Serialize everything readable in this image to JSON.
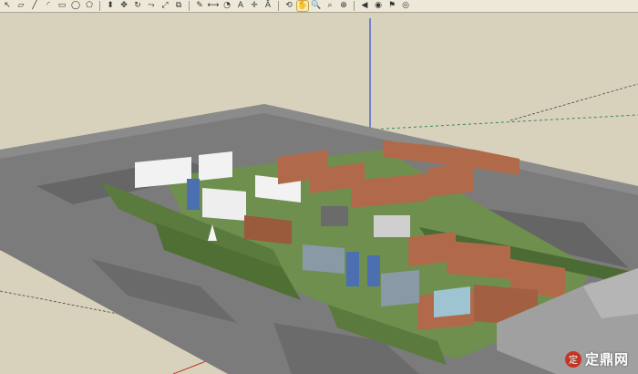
{
  "toolbar": {
    "tools": [
      {
        "name": "select-tool-icon",
        "glyph": "↖",
        "active": false
      },
      {
        "name": "eraser-tool-icon",
        "glyph": "▱",
        "active": false
      },
      {
        "name": "line-tool-icon",
        "glyph": "╱",
        "active": false
      },
      {
        "name": "arc-tool-icon",
        "glyph": "◜",
        "active": false
      },
      {
        "name": "rectangle-tool-icon",
        "glyph": "▭",
        "active": false
      },
      {
        "name": "circle-tool-icon",
        "glyph": "◯",
        "active": false
      },
      {
        "name": "polygon-tool-icon",
        "glyph": "⬠",
        "active": false
      },
      {
        "name": "push-pull-tool-icon",
        "glyph": "⬍",
        "active": false
      },
      {
        "name": "move-tool-icon",
        "glyph": "✥",
        "active": false
      },
      {
        "name": "rotate-tool-icon",
        "glyph": "↻",
        "active": false
      },
      {
        "name": "follow-me-tool-icon",
        "glyph": "⤳",
        "active": false
      },
      {
        "name": "scale-tool-icon",
        "glyph": "⤢",
        "active": false
      },
      {
        "name": "offset-tool-icon",
        "glyph": "⧉",
        "active": false
      },
      {
        "name": "tape-measure-tool-icon",
        "glyph": "✎",
        "active": false
      },
      {
        "name": "dimension-tool-icon",
        "glyph": "⟷",
        "active": false
      },
      {
        "name": "protractor-tool-icon",
        "glyph": "◔",
        "active": false
      },
      {
        "name": "text-tool-icon",
        "glyph": "A",
        "active": false
      },
      {
        "name": "axes-tool-icon",
        "glyph": "✛",
        "active": false
      },
      {
        "name": "3d-text-tool-icon",
        "glyph": "Ā",
        "active": false
      },
      {
        "name": "orbit-tool-icon",
        "glyph": "⟲",
        "active": false
      },
      {
        "name": "pan-tool-icon",
        "glyph": "✋",
        "active": true
      },
      {
        "name": "zoom-tool-icon",
        "glyph": "🔍",
        "active": false
      },
      {
        "name": "zoom-window-tool-icon",
        "glyph": "⌕",
        "active": false
      },
      {
        "name": "zoom-extents-tool-icon",
        "glyph": "⊕",
        "active": false
      },
      {
        "name": "previous-view-icon",
        "glyph": "◀",
        "active": false
      },
      {
        "name": "position-camera-icon",
        "glyph": "◉",
        "active": false
      },
      {
        "name": "walk-tool-icon",
        "glyph": "⚑",
        "active": false
      },
      {
        "name": "look-around-icon",
        "glyph": "◎",
        "active": false
      }
    ]
  },
  "colors": {
    "ground_plane": "#d8d2bc",
    "aerial_map": "#7b7b7b",
    "lawn": "#6f8f4e",
    "brick": "#b06a4a",
    "blue_glass": "#4b6fb0",
    "white_block": "#f2f2f2",
    "red_axis": "#c0392b",
    "green_axis": "#2e8b57",
    "blue_axis": "#2b4fd0"
  },
  "watermark": {
    "brand": "定鼎网"
  }
}
